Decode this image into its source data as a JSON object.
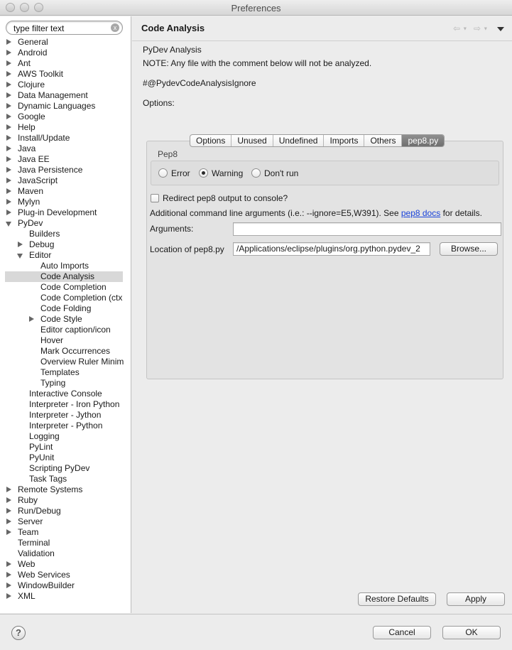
{
  "window": {
    "title": "Preferences"
  },
  "filter": {
    "placeholder": "type filter text",
    "clear_icon": "x"
  },
  "tree": [
    {
      "label": "General",
      "depth": 0,
      "twisty": "closed"
    },
    {
      "label": "Android",
      "depth": 0,
      "twisty": "closed"
    },
    {
      "label": "Ant",
      "depth": 0,
      "twisty": "closed"
    },
    {
      "label": "AWS Toolkit",
      "depth": 0,
      "twisty": "closed"
    },
    {
      "label": "Clojure",
      "depth": 0,
      "twisty": "closed"
    },
    {
      "label": "Data Management",
      "depth": 0,
      "twisty": "closed"
    },
    {
      "label": "Dynamic Languages",
      "depth": 0,
      "twisty": "closed"
    },
    {
      "label": "Google",
      "depth": 0,
      "twisty": "closed"
    },
    {
      "label": "Help",
      "depth": 0,
      "twisty": "closed"
    },
    {
      "label": "Install/Update",
      "depth": 0,
      "twisty": "closed"
    },
    {
      "label": "Java",
      "depth": 0,
      "twisty": "closed"
    },
    {
      "label": "Java EE",
      "depth": 0,
      "twisty": "closed"
    },
    {
      "label": "Java Persistence",
      "depth": 0,
      "twisty": "closed"
    },
    {
      "label": "JavaScript",
      "depth": 0,
      "twisty": "closed"
    },
    {
      "label": "Maven",
      "depth": 0,
      "twisty": "closed"
    },
    {
      "label": "Mylyn",
      "depth": 0,
      "twisty": "closed"
    },
    {
      "label": "Plug-in Development",
      "depth": 0,
      "twisty": "closed"
    },
    {
      "label": "PyDev",
      "depth": 0,
      "twisty": "open"
    },
    {
      "label": "Builders",
      "depth": 1,
      "twisty": "none"
    },
    {
      "label": "Debug",
      "depth": 1,
      "twisty": "closed"
    },
    {
      "label": "Editor",
      "depth": 1,
      "twisty": "open"
    },
    {
      "label": "Auto Imports",
      "depth": 2,
      "twisty": "none"
    },
    {
      "label": "Code Analysis",
      "depth": 2,
      "twisty": "none",
      "selected": true
    },
    {
      "label": "Code Completion",
      "depth": 2,
      "twisty": "none"
    },
    {
      "label": "Code Completion (ctx",
      "depth": 2,
      "twisty": "none"
    },
    {
      "label": "Code Folding",
      "depth": 2,
      "twisty": "none"
    },
    {
      "label": "Code Style",
      "depth": 2,
      "twisty": "closed"
    },
    {
      "label": "Editor caption/icon",
      "depth": 2,
      "twisty": "none"
    },
    {
      "label": "Hover",
      "depth": 2,
      "twisty": "none"
    },
    {
      "label": "Mark Occurrences",
      "depth": 2,
      "twisty": "none"
    },
    {
      "label": "Overview Ruler Minim",
      "depth": 2,
      "twisty": "none"
    },
    {
      "label": "Templates",
      "depth": 2,
      "twisty": "none"
    },
    {
      "label": "Typing",
      "depth": 2,
      "twisty": "none"
    },
    {
      "label": "Interactive Console",
      "depth": 1,
      "twisty": "none"
    },
    {
      "label": "Interpreter - Iron Python",
      "depth": 1,
      "twisty": "none"
    },
    {
      "label": "Interpreter - Jython",
      "depth": 1,
      "twisty": "none"
    },
    {
      "label": "Interpreter - Python",
      "depth": 1,
      "twisty": "none"
    },
    {
      "label": "Logging",
      "depth": 1,
      "twisty": "none"
    },
    {
      "label": "PyLint",
      "depth": 1,
      "twisty": "none"
    },
    {
      "label": "PyUnit",
      "depth": 1,
      "twisty": "none"
    },
    {
      "label": "Scripting PyDev",
      "depth": 1,
      "twisty": "none"
    },
    {
      "label": "Task Tags",
      "depth": 1,
      "twisty": "none"
    },
    {
      "label": "Remote Systems",
      "depth": 0,
      "twisty": "closed"
    },
    {
      "label": "Ruby",
      "depth": 0,
      "twisty": "closed"
    },
    {
      "label": "Run/Debug",
      "depth": 0,
      "twisty": "closed"
    },
    {
      "label": "Server",
      "depth": 0,
      "twisty": "closed"
    },
    {
      "label": "Team",
      "depth": 0,
      "twisty": "closed"
    },
    {
      "label": "Terminal",
      "depth": 0,
      "twisty": "none"
    },
    {
      "label": "Validation",
      "depth": 0,
      "twisty": "none"
    },
    {
      "label": "Web",
      "depth": 0,
      "twisty": "closed"
    },
    {
      "label": "Web Services",
      "depth": 0,
      "twisty": "closed"
    },
    {
      "label": "WindowBuilder",
      "depth": 0,
      "twisty": "closed"
    },
    {
      "label": "XML",
      "depth": 0,
      "twisty": "closed"
    }
  ],
  "page": {
    "title": "Code Analysis",
    "back_icon": "⇦",
    "forward_icon": "⇨",
    "section_title": "PyDev Analysis",
    "note": "NOTE: Any file with the comment below will not be analyzed.",
    "ignore_comment": "#@PydevCodeAnalysisIgnore",
    "options_label": "Options:",
    "tabs": [
      "Options",
      "Unused",
      "Undefined",
      "Imports",
      "Others",
      "pep8.py"
    ],
    "active_tab": "pep8.py",
    "pep8_group": "Pep8",
    "radios": {
      "error": "Error",
      "warning": "Warning",
      "dont_run": "Don't run",
      "selected": "Warning"
    },
    "redirect_label": "Redirect pep8 output to console?",
    "redirect_checked": false,
    "args_prefix": "Additional command line arguments (i.e.: --ignore=E5,W391). See ",
    "args_link": "pep8 docs",
    "args_suffix": " for details.",
    "arguments_label": "Arguments:",
    "arguments_value": "",
    "location_label": "Location of pep8.py",
    "location_value": "/Applications/eclipse/plugins/org.python.pydev_2",
    "browse_label": "Browse...",
    "restore_label": "Restore Defaults",
    "apply_label": "Apply"
  },
  "footer": {
    "help_glyph": "?",
    "cancel_label": "Cancel",
    "ok_label": "OK"
  }
}
